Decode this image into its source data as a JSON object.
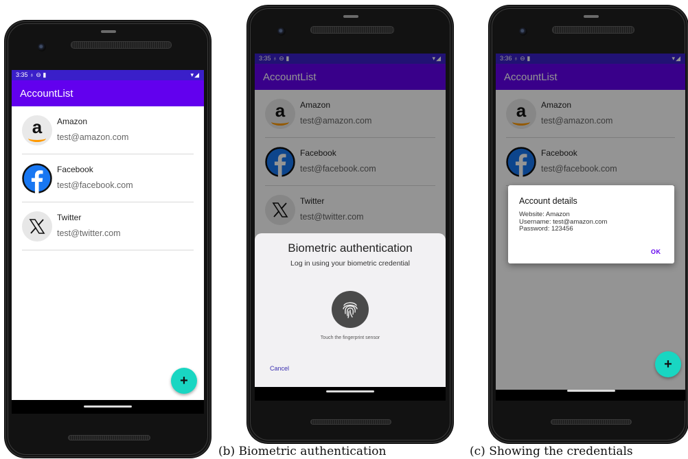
{
  "screens": [
    {
      "status": {
        "time": "3:35",
        "icons": "♁ ⊖ ▮",
        "right": "▾◢"
      },
      "title": "AccountList",
      "accounts": [
        {
          "name": "Amazon",
          "email": "test@amazon.com",
          "icon": "amazon-logo"
        },
        {
          "name": "Facebook",
          "email": "test@facebook.com",
          "icon": "facebook-logo"
        },
        {
          "name": "Twitter",
          "email": "test@twitter.com",
          "icon": "x-logo"
        }
      ],
      "fab": "+"
    },
    {
      "status": {
        "time": "3:35",
        "icons": "♁ ⊖ ▮",
        "right": "▾◢"
      },
      "title": "AccountList",
      "accounts": [
        {
          "name": "Amazon",
          "email": "test@amazon.com",
          "icon": "amazon-logo"
        },
        {
          "name": "Facebook",
          "email": "test@facebook.com",
          "icon": "facebook-logo"
        },
        {
          "name": "Twitter",
          "email": "test@twitter.com",
          "icon": "x-logo"
        }
      ],
      "biometric": {
        "title": "Biometric authentication",
        "subtitle": "Log in using your biometric credential",
        "hint": "Touch the fingerprint sensor",
        "cancel": "Cancel"
      }
    },
    {
      "status": {
        "time": "3:36",
        "icons": "♁ ⊖ ▮",
        "right": "▾◢"
      },
      "title": "AccountList",
      "accounts": [
        {
          "name": "Amazon",
          "email": "test@amazon.com",
          "icon": "amazon-logo"
        },
        {
          "name": "Facebook",
          "email": "test@facebook.com",
          "icon": "facebook-logo"
        }
      ],
      "dialog": {
        "title": "Account details",
        "lines": [
          "Website: Amazon",
          "Username: test@amazon.com",
          "Password: 123456"
        ],
        "ok": "OK"
      },
      "fab": "+"
    }
  ],
  "captions": {
    "b": "(b)  Biometric authentication",
    "c": "(c)  Showing the credentials"
  },
  "colors": {
    "appbar": "#6200ee",
    "statusbar": "#3a1fc9",
    "fab": "#19d6c2",
    "accent": "#6200ee"
  }
}
